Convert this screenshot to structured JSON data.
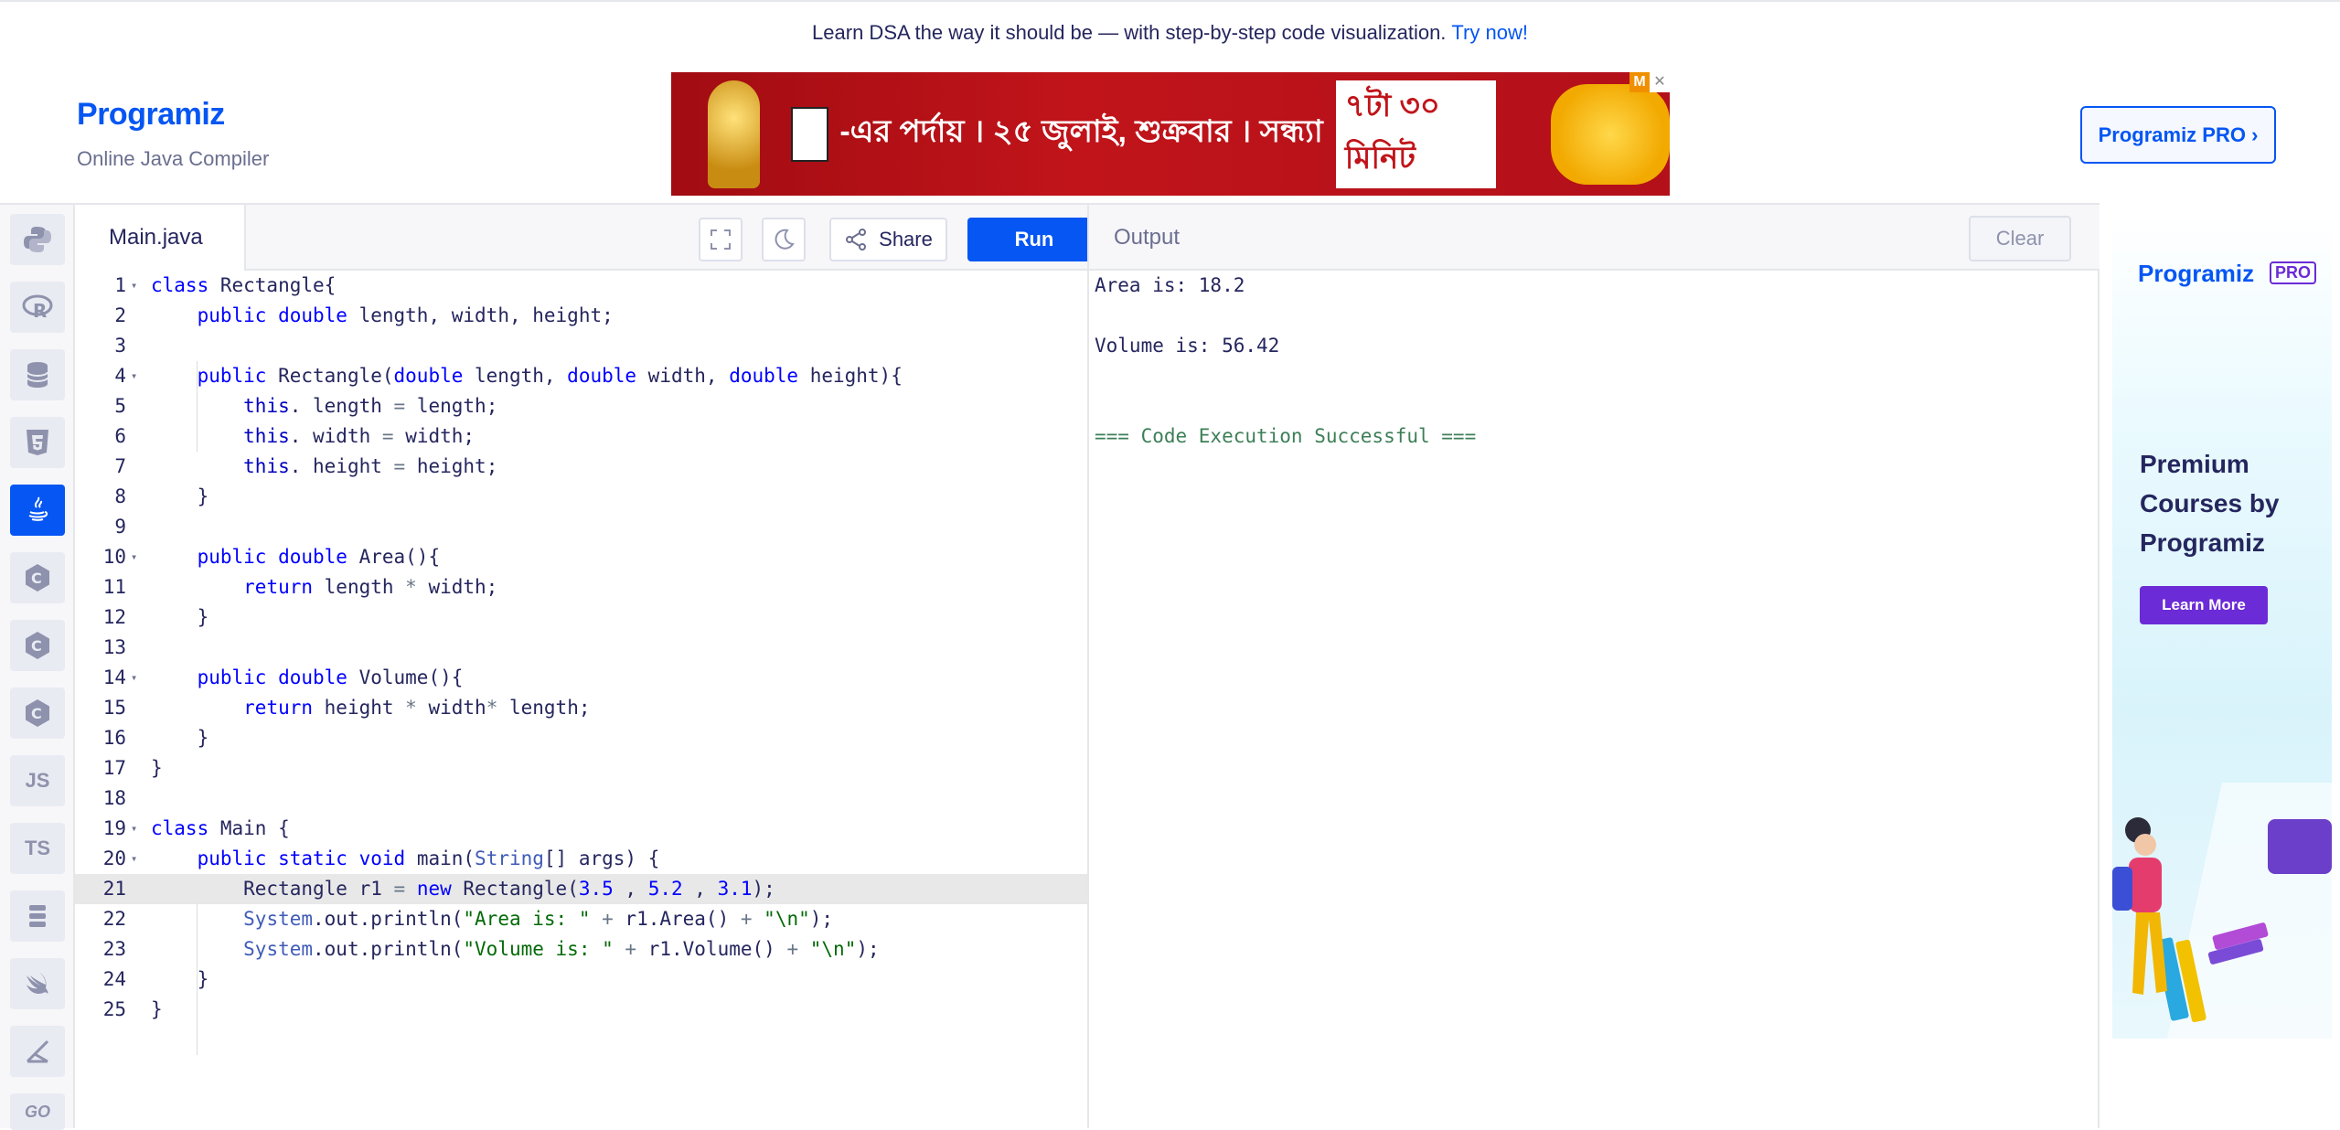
{
  "top_banner": {
    "text": "Learn DSA the way it should be — with step-by-step code visualization.",
    "link": "Try now!"
  },
  "header": {
    "logo": "rogramiz",
    "subtitle": "Online Java Compiler",
    "pro_button": "Programiz PRO ›"
  },
  "ad_banner": {
    "text": "-এর পর্দায় । ২৫ জুলাই, শুক্রবার । সন্ধ্যা",
    "time": "৭টা ৩০ মিনিট",
    "close": [
      "M",
      "✕"
    ]
  },
  "sidebar": {
    "items": [
      {
        "icon": "python-icon"
      },
      {
        "icon": "r-lang-icon"
      },
      {
        "icon": "sql-icon"
      },
      {
        "icon": "html5-icon"
      },
      {
        "icon": "java-icon",
        "active": true
      },
      {
        "icon": "c-lang-icon"
      },
      {
        "icon": "cpp-icon"
      },
      {
        "icon": "csharp-icon"
      },
      {
        "icon": "javascript-icon",
        "label": "JS"
      },
      {
        "icon": "typescript-icon",
        "label": "TS"
      },
      {
        "icon": "rust-icon"
      },
      {
        "icon": "swift-icon"
      },
      {
        "icon": "kotlin-icon"
      },
      {
        "icon": "go-icon",
        "label": "GO"
      }
    ]
  },
  "editor": {
    "file_name": "Main.java",
    "share_label": "Share",
    "run_label": "Run",
    "current_line": 21,
    "lines": [
      "class Rectangle{",
      "    public double length, width, height;",
      "",
      "    public Rectangle(double length, double width, double height){",
      "        this. length = length;",
      "        this. width = width;",
      "        this. height = height;",
      "    }",
      "",
      "    public double Area(){",
      "        return length * width;",
      "    }",
      "",
      "    public double Volume(){",
      "        return height * width* length;",
      "    }",
      "}",
      "",
      "class Main {",
      "    public static void main(String[] args) {",
      "        Rectangle r1 = new Rectangle(3.5 , 5.2 , 3.1);",
      "        System.out.println(\"Area is: \" + r1.Area() + \"\\n\");",
      "        System.out.println(\"Volume is: \" + r1.Volume() + \"\\n\");",
      "    }",
      "}"
    ],
    "fold_lines": [
      1,
      4,
      10,
      14,
      19,
      20
    ]
  },
  "output": {
    "title": "Output",
    "clear_label": "Clear",
    "lines": [
      "Area is: 18.2",
      "",
      "Volume is: 56.42",
      "",
      "",
      "=== Code Execution Successful ==="
    ]
  },
  "side_ad": {
    "logo": "rogramiz",
    "badge": "PRO",
    "headline": "Premium Courses by Programiz",
    "button": "Learn More"
  },
  "colors": {
    "accent": "#0556f3",
    "pro_purple": "#6b2bd6",
    "success": "#3c7f57"
  }
}
